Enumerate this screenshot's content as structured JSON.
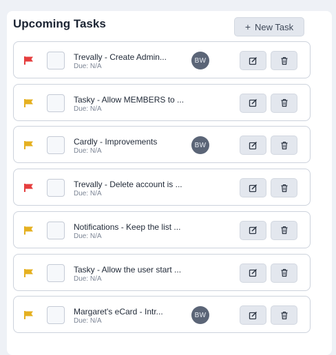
{
  "header": {
    "title": "Upcoming Tasks",
    "new_task_label": "New Task"
  },
  "colors": {
    "flag_high": "#e53e3e",
    "flag_medium": "#e5b020",
    "avatar_bg": "#5b6577"
  },
  "tasks": [
    {
      "name": "Trevally - Create Admin...",
      "due": "Due: N/A",
      "priority": "high",
      "assignee": "BW"
    },
    {
      "name": "Tasky - Allow MEMBERS to ...",
      "due": "Due: N/A",
      "priority": "medium",
      "assignee": ""
    },
    {
      "name": "Cardly - Improvements",
      "due": "Due: N/A",
      "priority": "medium",
      "assignee": "BW"
    },
    {
      "name": "Trevally - Delete account is ...",
      "due": "Due: N/A",
      "priority": "high",
      "assignee": ""
    },
    {
      "name": "Notifications - Keep the list ...",
      "due": "Due: N/A",
      "priority": "medium",
      "assignee": ""
    },
    {
      "name": "Tasky - Allow the user start ...",
      "due": "Due: N/A",
      "priority": "medium",
      "assignee": ""
    },
    {
      "name": "Margaret's eCard - Intr...",
      "due": "Due: N/A",
      "priority": "medium",
      "assignee": "BW"
    }
  ]
}
